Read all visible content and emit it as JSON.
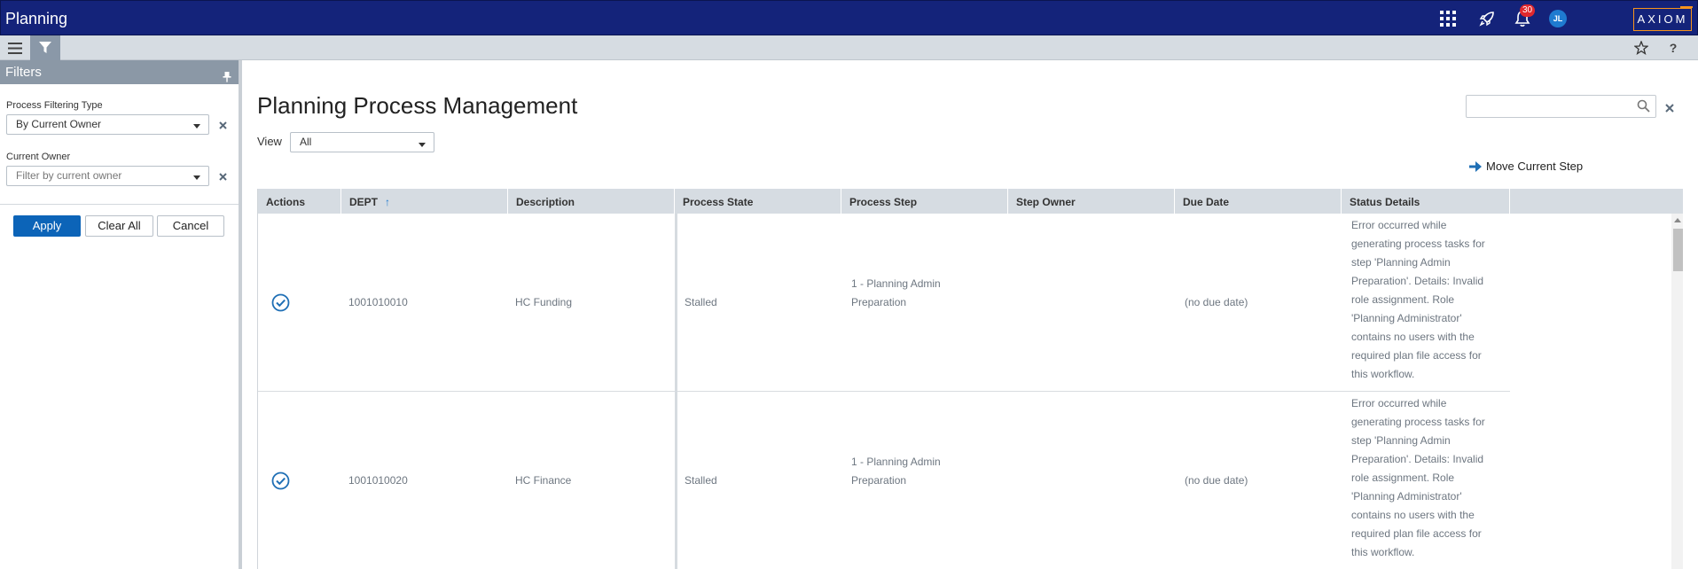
{
  "app": {
    "title": "Planning",
    "notification_count": "30",
    "user_initials": "JL",
    "logo_text": "AXIOM",
    "colors": {
      "topbar": "#14237a",
      "accent": "#0c64b8",
      "logo_border": "#f7941d",
      "badge": "#e0282e"
    }
  },
  "toolbar": {
    "menu_icon": "hamburger-menu-icon",
    "filter_icon": "filter-funnel-icon",
    "star_icon": "star-outline-icon",
    "help_label": "?"
  },
  "filters": {
    "title": "Filters",
    "process_filtering_type": {
      "label": "Process Filtering Type",
      "value": "By Current Owner"
    },
    "current_owner": {
      "label": "Current Owner",
      "placeholder": "Filter by current owner"
    },
    "buttons": {
      "apply": "Apply",
      "clear_all": "Clear All",
      "cancel": "Cancel"
    }
  },
  "main": {
    "title": "Planning Process Management",
    "view": {
      "label": "View",
      "value": "All"
    },
    "search": {
      "placeholder": ""
    },
    "move_step_label": "Move Current Step"
  },
  "table": {
    "columns": [
      "Actions",
      "DEPT",
      "Description",
      "Process State",
      "Process Step",
      "Step Owner",
      "Due Date",
      "Status Details"
    ],
    "rows": [
      {
        "dept": "1001010010",
        "description": "HC Funding",
        "state": "Stalled",
        "step_line1": "1 - Planning Admin",
        "step_line2": "Preparation",
        "owner": "",
        "due_date": "(no due date)",
        "status_lines": [
          "Error occurred while",
          "generating process tasks for",
          "step 'Planning Admin",
          "Preparation'. Details: Invalid",
          "role assignment. Role",
          "'Planning Administrator'",
          "contains no users with the",
          "required plan file access for",
          "this workflow."
        ]
      },
      {
        "dept": "1001010020",
        "description": "HC Finance",
        "state": "Stalled",
        "step_line1": "1 - Planning Admin",
        "step_line2": "Preparation",
        "owner": "",
        "due_date": "(no due date)",
        "status_lines": [
          "Error occurred while",
          "generating process tasks for",
          "step 'Planning Admin",
          "Preparation'. Details: Invalid",
          "role assignment. Role",
          "'Planning Administrator'",
          "contains no users with the",
          "required plan file access for",
          "this workflow."
        ]
      }
    ]
  }
}
